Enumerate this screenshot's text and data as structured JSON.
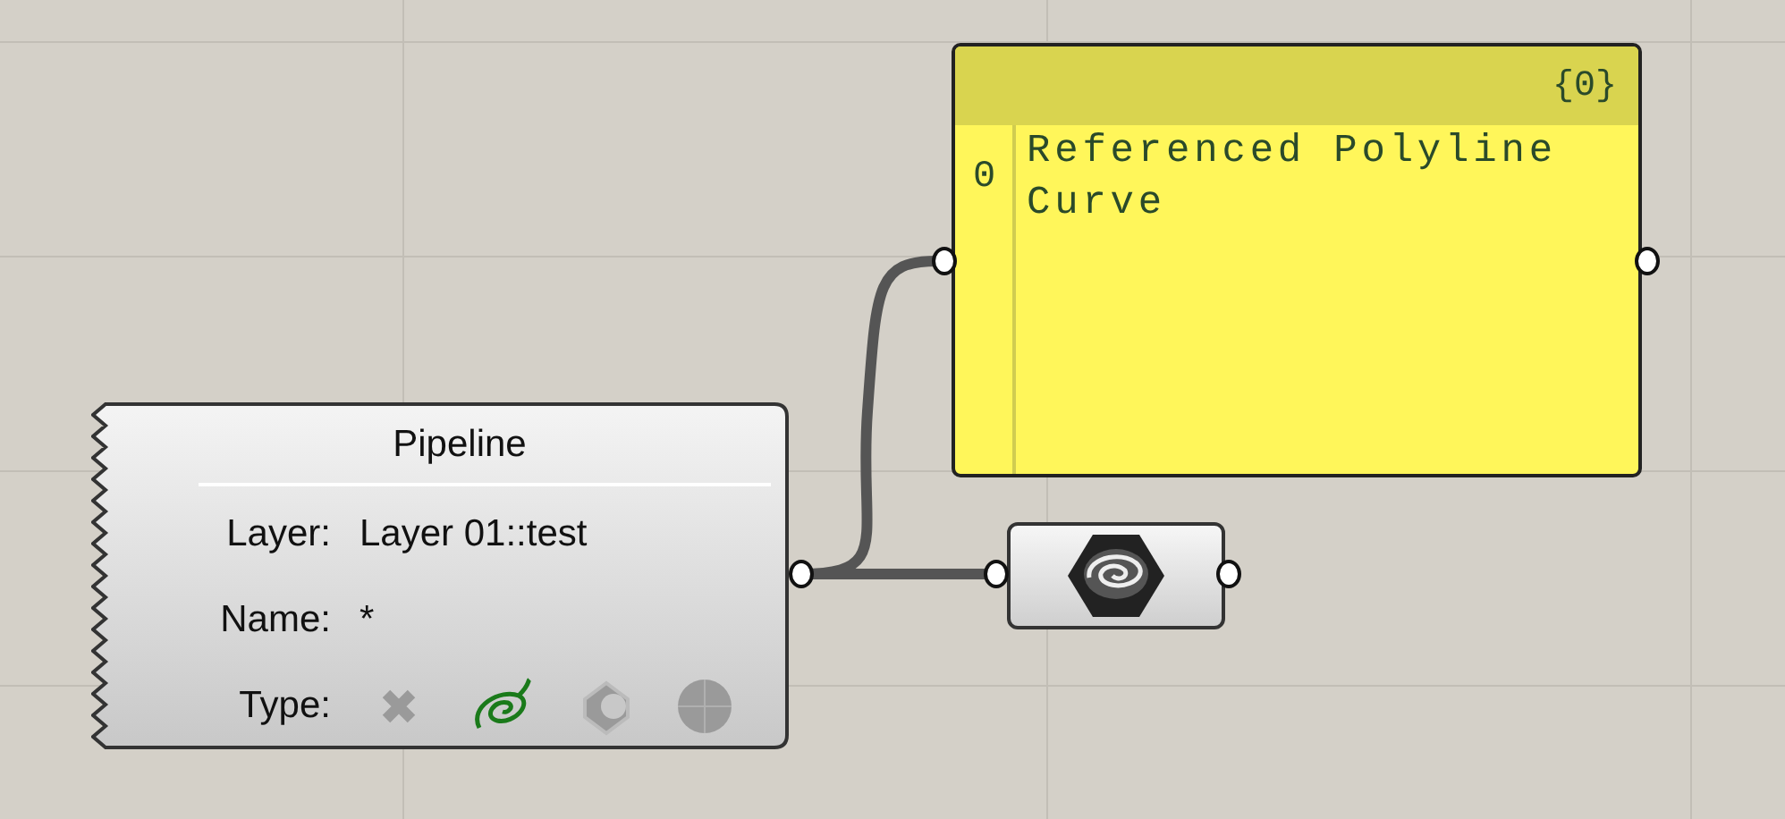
{
  "pipeline": {
    "title": "Pipeline",
    "fields": [
      {
        "label": "Layer:",
        "value": "Layer 01::test"
      },
      {
        "label": "Name:",
        "value": "*"
      }
    ],
    "type": {
      "label": "Type:",
      "options": [
        {
          "kind": "point",
          "selected": false
        },
        {
          "kind": "curve",
          "selected": true
        },
        {
          "kind": "brep",
          "selected": false
        },
        {
          "kind": "mesh",
          "selected": false
        }
      ]
    }
  },
  "panel": {
    "path": "{0}",
    "items": [
      {
        "index": "0",
        "text": "Referenced Polyline Curve"
      }
    ]
  }
}
